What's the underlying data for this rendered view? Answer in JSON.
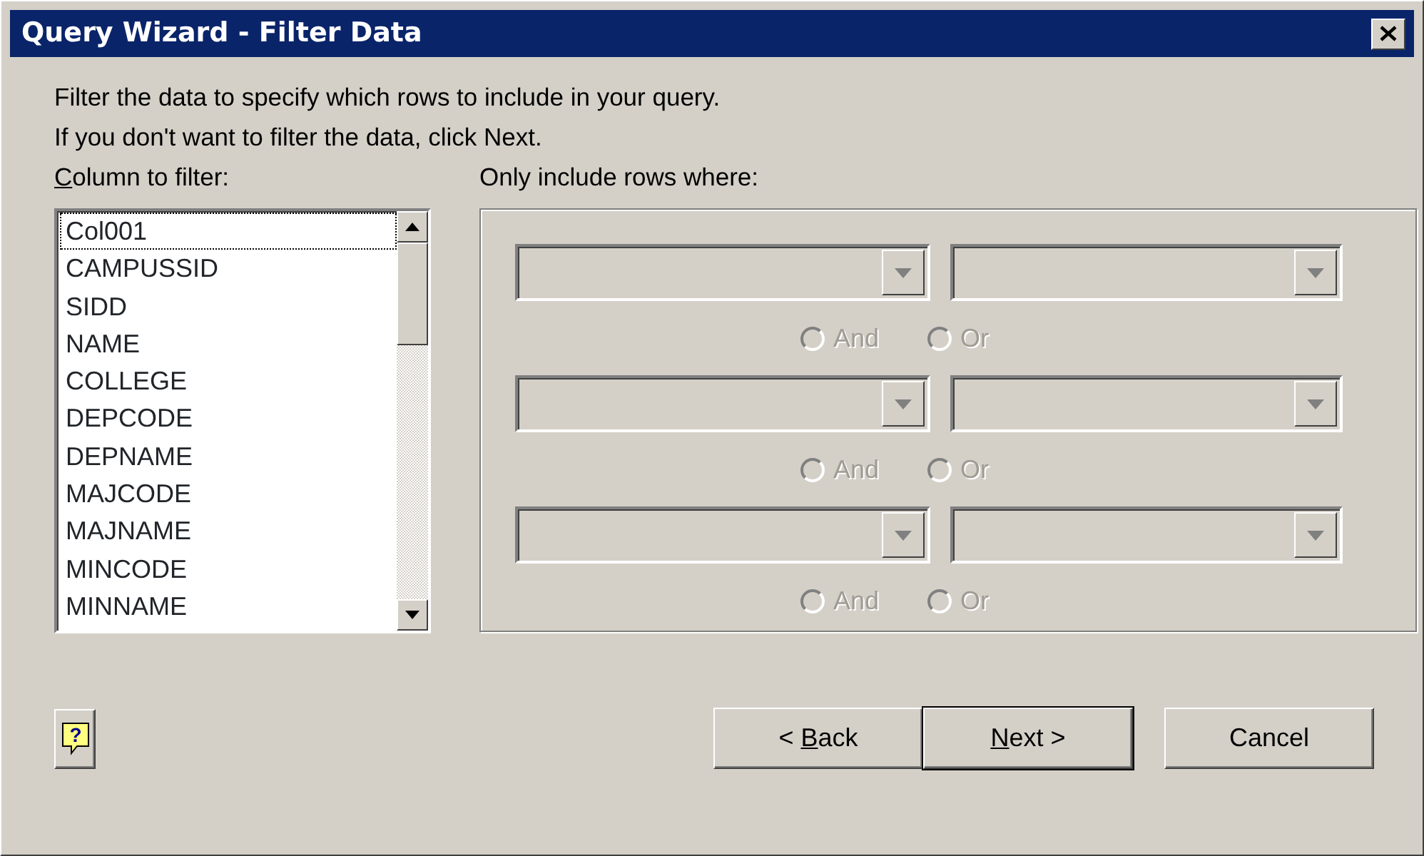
{
  "window": {
    "title": "Query Wizard - Filter Data"
  },
  "instructions": [
    "Filter the data to specify which rows to include in your query.",
    "If you don't want to filter the data, click Next."
  ],
  "column_list": {
    "label_key": "C",
    "label_rest": "olumn to filter:",
    "items": [
      {
        "text": "Col001",
        "selected": true
      },
      {
        "text": "CAMPUSSID",
        "selected": false
      },
      {
        "text": "SIDD",
        "selected": false
      },
      {
        "text": "NAME",
        "selected": false
      },
      {
        "text": "COLLEGE",
        "selected": false
      },
      {
        "text": "DEPCODE",
        "selected": false
      },
      {
        "text": "DEPNAME",
        "selected": false
      },
      {
        "text": "MAJCODE",
        "selected": false
      },
      {
        "text": "MAJNAME",
        "selected": false
      },
      {
        "text": "MINCODE",
        "selected": false
      },
      {
        "text": "MINNAME",
        "selected": false
      }
    ]
  },
  "criteria": {
    "label": "Only include rows where:",
    "rows": [
      {
        "disabled": true,
        "and_option": {
          "label": "And",
          "checked": false
        },
        "or_option": {
          "label": "Or",
          "checked": false
        }
      },
      {
        "disabled": true,
        "and_option": {
          "label": "And",
          "checked": false
        },
        "or_option": {
          "label": "Or",
          "checked": false
        }
      },
      {
        "disabled": true,
        "and_option": {
          "label": "And",
          "checked": false
        },
        "or_option": {
          "label": "Or",
          "checked": false
        }
      }
    ]
  },
  "buttons": [
    {
      "kind": "help",
      "symbol": "?"
    },
    {
      "kind": "nav",
      "label_lead": "< ",
      "label_key": "B",
      "label_rest": "ack",
      "default": false
    },
    {
      "kind": "nav",
      "label_key": "N",
      "label_rest": "ext >",
      "default": true
    },
    {
      "kind": "nav",
      "label": "Cancel",
      "default": false
    }
  ]
}
